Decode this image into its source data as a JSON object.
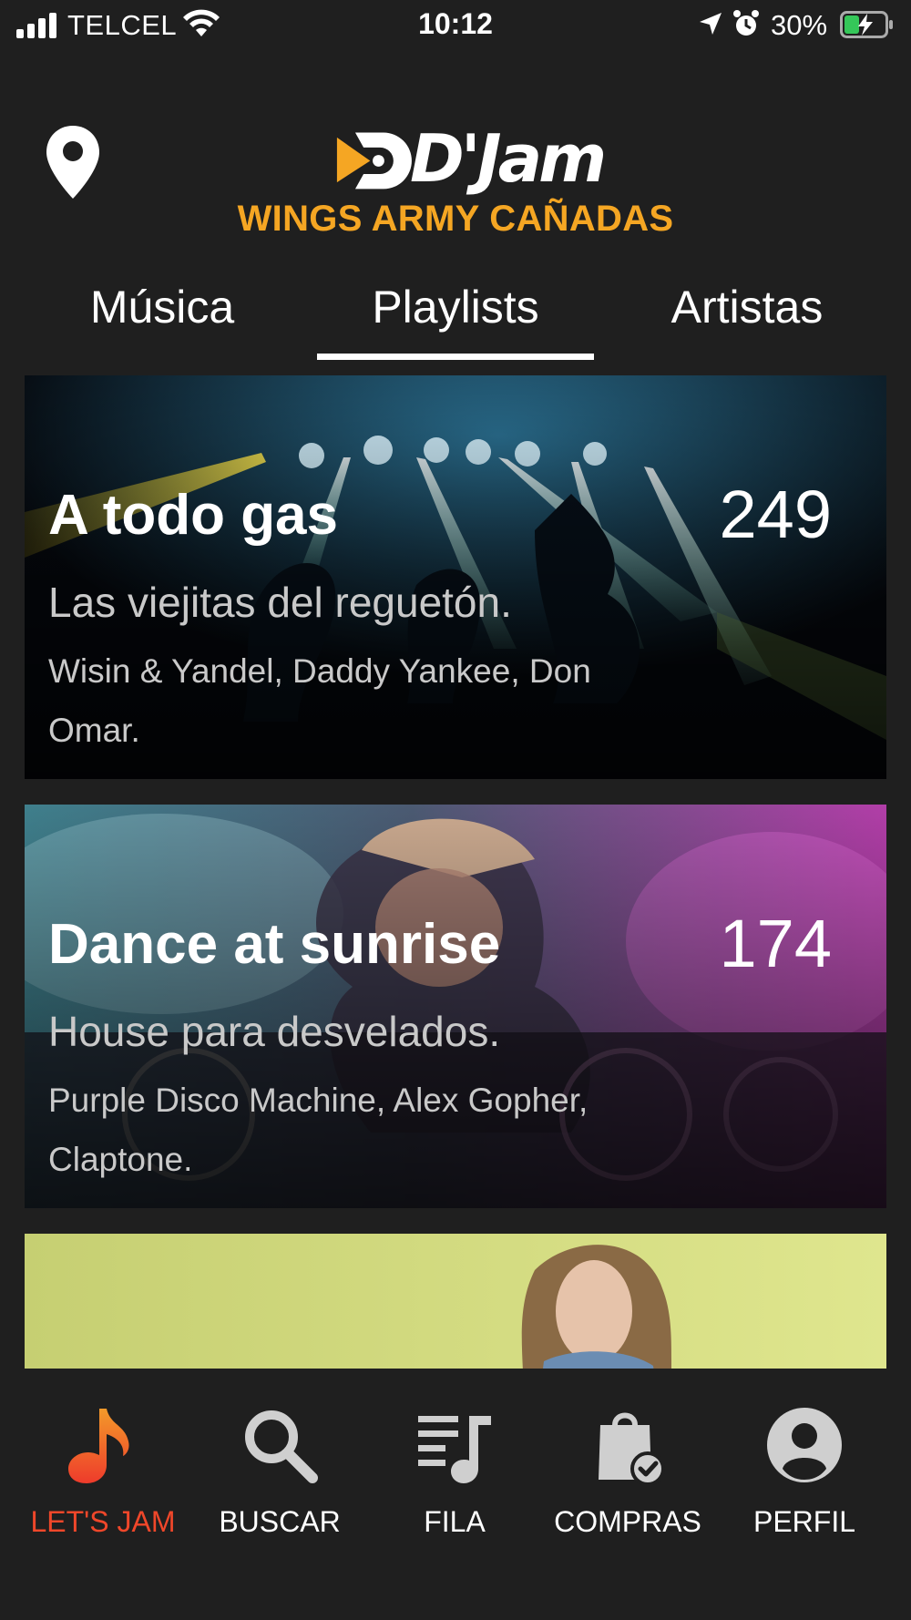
{
  "status_bar": {
    "carrier": "TELCEL",
    "time": "10:12",
    "battery": "30%"
  },
  "header": {
    "logo_text": "D'Jam",
    "venue": "WINGS ARMY CAÑADAS"
  },
  "tabs": [
    {
      "label": "Música",
      "active": false
    },
    {
      "label": "Playlists",
      "active": true
    },
    {
      "label": "Artistas",
      "active": false
    }
  ],
  "playlists": [
    {
      "title": "A todo gas",
      "count": "249",
      "subtitle": "Las viejitas del reguetón.",
      "artists": "Wisin & Yandel, Daddy Yankee, Don Omar."
    },
    {
      "title": "Dance at sunrise",
      "count": "174",
      "subtitle": "House para desvelados.",
      "artists": "Purple Disco Machine, Alex Gopher, Claptone."
    },
    {
      "title": "",
      "count": "",
      "subtitle": "",
      "artists": ""
    }
  ],
  "bottom_nav": [
    {
      "label": "LET'S JAM",
      "icon": "music-note-icon",
      "active": true
    },
    {
      "label": "BUSCAR",
      "icon": "search-icon",
      "active": false
    },
    {
      "label": "FILA",
      "icon": "queue-icon",
      "active": false
    },
    {
      "label": "COMPRAS",
      "icon": "shopping-bag-icon",
      "active": false
    },
    {
      "label": "PERFIL",
      "icon": "profile-icon",
      "active": false
    }
  ],
  "colors": {
    "background": "#1f1f1f",
    "accent_orange": "#f5a623",
    "active_red": "#f0472a",
    "text_primary": "#ffffff",
    "text_secondary": "#c9c9c9"
  }
}
